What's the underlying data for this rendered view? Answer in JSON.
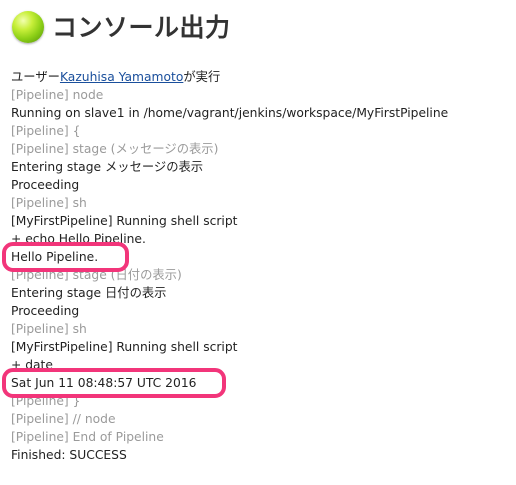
{
  "header": {
    "icon": "status-ball-green-icon",
    "title": "コンソール出力"
  },
  "console": {
    "started_by": {
      "prefix": "ユーザー",
      "user": "Kazuhisa Yamamoto",
      "suffix": "が実行"
    },
    "lines": [
      {
        "text": "[Pipeline] node",
        "kind": "pipeline"
      },
      {
        "text": "Running on slave1 in /home/vagrant/jenkins/workspace/MyFirstPipeline",
        "kind": "normal"
      },
      {
        "text": "[Pipeline] {",
        "kind": "pipeline"
      },
      {
        "text": "[Pipeline] stage (メッセージの表示)",
        "kind": "pipeline"
      },
      {
        "text": "Entering stage メッセージの表示",
        "kind": "normal"
      },
      {
        "text": "Proceeding",
        "kind": "normal"
      },
      {
        "text": "[Pipeline] sh",
        "kind": "pipeline"
      },
      {
        "text": "[MyFirstPipeline] Running shell script",
        "kind": "normal"
      },
      {
        "text": "+ echo Hello Pipeline.",
        "kind": "normal"
      },
      {
        "text": "Hello Pipeline.",
        "kind": "normal",
        "highlight": true
      },
      {
        "text": "[Pipeline] stage (日付の表示)",
        "kind": "pipeline"
      },
      {
        "text": "Entering stage 日付の表示",
        "kind": "normal"
      },
      {
        "text": "Proceeding",
        "kind": "normal"
      },
      {
        "text": "[Pipeline] sh",
        "kind": "pipeline"
      },
      {
        "text": "[MyFirstPipeline] Running shell script",
        "kind": "normal"
      },
      {
        "text": "+ date",
        "kind": "normal"
      },
      {
        "text": "Sat Jun 11 08:48:57 UTC 2016",
        "kind": "normal",
        "highlight": true
      },
      {
        "text": "[Pipeline] }",
        "kind": "pipeline"
      },
      {
        "text": "[Pipeline] // node",
        "kind": "pipeline"
      },
      {
        "text": "[Pipeline] End of Pipeline",
        "kind": "pipeline"
      },
      {
        "text": "Finished: SUCCESS",
        "kind": "normal"
      }
    ]
  },
  "colors": {
    "pipeline_text": "#9a9a9a",
    "normal_text": "#222222",
    "link": "#1a4f9c",
    "highlight": "#f2357a",
    "status_ball": "#8ccf16"
  }
}
